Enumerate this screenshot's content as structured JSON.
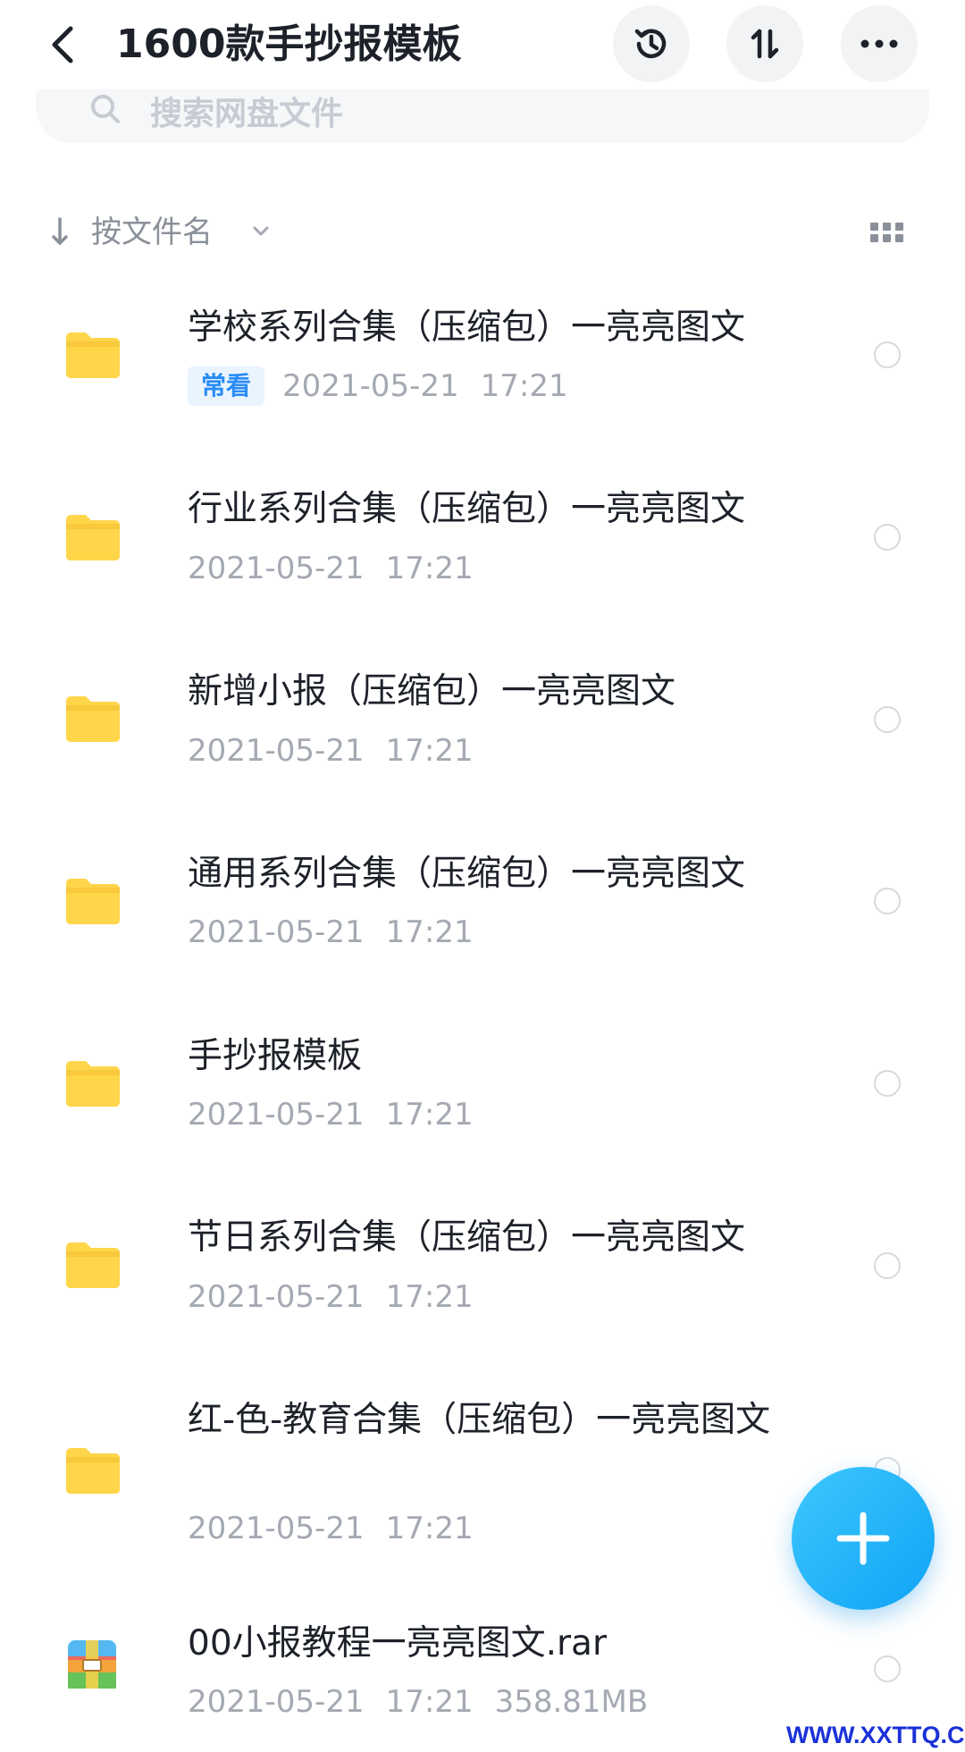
{
  "header": {
    "title": "1600款手抄报模板",
    "search_placeholder": "搜索网盘文件"
  },
  "sort": {
    "label": "按文件名"
  },
  "files": [
    {
      "name": "学校系列合集（压缩包）一亮亮图文",
      "badge": "常看",
      "date": "2021-05-21",
      "time": "17:21",
      "icon": "folder-icon"
    },
    {
      "name": "行业系列合集（压缩包）一亮亮图文",
      "date": "2021-05-21",
      "time": "17:21",
      "icon": "folder-icon"
    },
    {
      "name": "新增小报（压缩包）一亮亮图文",
      "date": "2021-05-21",
      "time": "17:21",
      "icon": "folder-icon"
    },
    {
      "name": "通用系列合集（压缩包）一亮亮图文",
      "date": "2021-05-21",
      "time": "17:21",
      "icon": "folder-icon"
    },
    {
      "name": "手抄报模板",
      "date": "2021-05-21",
      "time": "17:21",
      "icon": "folder-icon"
    },
    {
      "name": "节日系列合集（压缩包）一亮亮图文",
      "date": "2021-05-21",
      "time": "17:21",
      "icon": "folder-icon"
    },
    {
      "name": "红-色-教育合集（压缩包）一亮亮图文",
      "date": "2021-05-21",
      "time": "17:21",
      "icon": "folder-icon"
    },
    {
      "name": "00小报教程一亮亮图文.rar",
      "date": "2021-05-21",
      "time": "17:21",
      "size": "358.81MB",
      "icon": "archive-icon"
    }
  ],
  "watermark": "WWW.XXTTQ.COM",
  "colors": {
    "folder": "#ffd54a",
    "accent": "#1fb0f8",
    "badge_text": "#2a8df5",
    "meta_text": "#a4a9b2"
  }
}
